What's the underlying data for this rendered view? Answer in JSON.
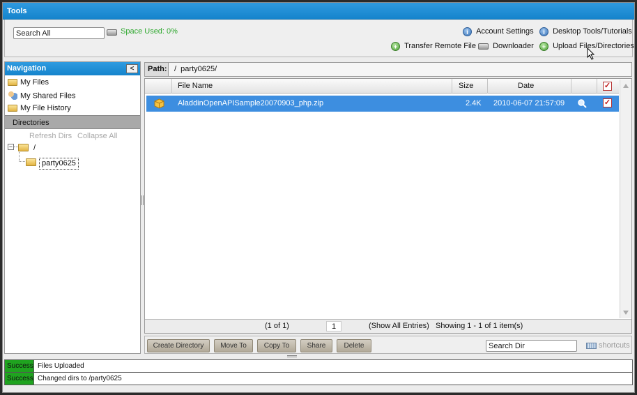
{
  "tools": {
    "title": "Tools",
    "search_placeholder": "Search All",
    "space_used": "Space Used: 0%",
    "links": {
      "account_settings": "Account Settings",
      "desktop_tools": "Desktop Tools/Tutorials",
      "transfer_remote": "Transfer Remote File",
      "downloader": "Downloader",
      "upload": "Upload Files/Directories"
    }
  },
  "navigation": {
    "title": "Navigation",
    "collapse_glyph": "<",
    "items": [
      "My Files",
      "My Shared Files",
      "My File History"
    ],
    "directories_label": "Directories",
    "refresh_dirs": "Refresh Dirs",
    "collapse_all": "Collapse All",
    "tree": {
      "expander": "−",
      "root": "/",
      "child": "party0625"
    }
  },
  "path": {
    "label": "Path:",
    "value": "/  party0625/"
  },
  "grid": {
    "columns": {
      "name": "File Name",
      "size": "Size",
      "date": "Date"
    },
    "check_glyph": "✓",
    "rows": [
      {
        "name": "AladdinOpenAPISample20070903_php.zip",
        "size": "2.4K",
        "date": "2010-06-07 21:57:09",
        "selected": true
      }
    ],
    "footer": {
      "page_of": "(1 of 1)",
      "page_input": "1",
      "show_all": "(Show All Entries)",
      "showing": "Showing 1 - 1 of 1 item(s)"
    }
  },
  "toolbar": {
    "create_directory": "Create Directory",
    "move_to": "Move To",
    "copy_to": "Copy To",
    "share": "Share",
    "delete": "Delete",
    "search_dir_placeholder": "Search Dir",
    "shortcuts": "shortcuts"
  },
  "status_log": [
    {
      "badge": "Success",
      "message": "Files Uploaded"
    },
    {
      "badge": "Success",
      "message": "Changed dirs to /party0625"
    }
  ],
  "colors": {
    "header_blue": "#1f8fd6",
    "row_selected": "#3d8ee0",
    "success_green": "#1fa31f",
    "space_used_green": "#2fa82f"
  }
}
